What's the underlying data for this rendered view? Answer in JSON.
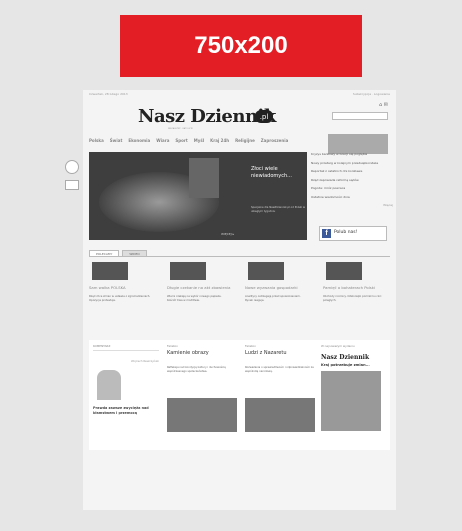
{
  "banner": {
    "text": "750x200",
    "color": "#e31e24"
  },
  "site": {
    "top_left": "Czwartek, 28 lutego 2013",
    "top_right": "Subskrypcja · Logowanie",
    "logo": "Nasz Dziennik",
    "logo_badge": ".pl",
    "tagline": "NIEZALEŻNY · KATOLICKI",
    "util_icons": "⌂ ✉",
    "search_placeholder": "",
    "nav": [
      "Polska",
      "Świat",
      "Ekonomia",
      "Wiara",
      "Sport",
      "Myśl",
      "Kraj 24h",
      "Religijne",
      "Zaproszenia"
    ]
  },
  "hero": {
    "title": "Złoci wiele niewiadomych...",
    "desc": "Specjalne dla NaszDziennik.pl od Polski w ubiegłym tygodniu",
    "more": "WIĘCEJ ▸"
  },
  "news": {
    "items": [
      "Kryzys bankowy w Grecji się pogłębia",
      "Nowy przetarg w kolejnym przedsiębiorstwie",
      "Reportaż z ostatnich dni konklawe",
      "Rząd zapowiada reformę sądów",
      "Pogoda: mróz powraca",
      "Ostatnie wiadomości dnia"
    ],
    "more": "Więcej"
  },
  "facebook": {
    "label": "Polub nas!"
  },
  "sections": {
    "tabs": [
      "POLECAMY",
      "WIDEO"
    ]
  },
  "cards": [
    {
      "title": "Sam walka POLSKA",
      "body": "Rząd chce zmian w ustawie o zgromadzeniach. Opozycja protestuje."
    },
    {
      "title": "Długie czekanie na akt zbawienia",
      "body": "Wierni czekają na wybór nowego papieża. Kościół trwa w modlitwie."
    },
    {
      "title": "Nowe wyzwania gospodarki",
      "body": "Analitycy ostrzegają przed spowolnieniem. Rynek reaguje."
    },
    {
      "title": "Pamięć o bohaterach Polski",
      "body": "Obchody rocznicy. Odsłonięto pomnik ku czci poległych."
    }
  ],
  "bottom": {
    "col1": {
      "label": "KOMENTARZ",
      "author": "Wojciech Reszczyński",
      "quote": "Prawda zawsze zwycięża nad kłamstwem i przemocą"
    },
    "col2": {
      "label": "Felieton",
      "head": "Kamienie obrazy",
      "text": "Refleksja nad kondycją kultury i duchowością współczesnego społeczeństwa."
    },
    "col3": {
      "label": "Felieton",
      "head": "Ludzi z Nazaretu",
      "text": "Rozważania o sprawiedliwości i odpowiedzialności za wspólnotę narodową."
    },
    "col4": {
      "label": "W najnowszym wydaniu",
      "paper": "Nasz Dziennik",
      "headline": "Kraj potrzebuje zmian..."
    }
  }
}
